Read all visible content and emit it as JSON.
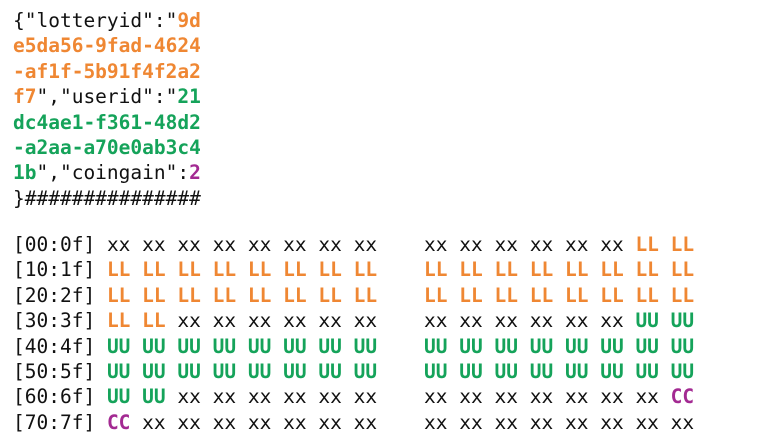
{
  "json_lines": [
    [
      {
        "t": "{\"lotteryid\":\"",
        "c": "plain"
      },
      {
        "t": "9d",
        "c": "L"
      }
    ],
    [
      {
        "t": "e5da56-9fad-4624",
        "c": "L"
      }
    ],
    [
      {
        "t": "-af1f-5b91f4f2a2",
        "c": "L"
      }
    ],
    [
      {
        "t": "f7",
        "c": "L"
      },
      {
        "t": "\",\"userid\":\"",
        "c": "plain"
      },
      {
        "t": "21",
        "c": "U"
      }
    ],
    [
      {
        "t": "dc4ae1-f361-48d2",
        "c": "U"
      }
    ],
    [
      {
        "t": "-a2aa-a70e0ab3c4",
        "c": "U"
      }
    ],
    [
      {
        "t": "1b",
        "c": "U"
      },
      {
        "t": "\",\"coingain\":",
        "c": "plain"
      },
      {
        "t": "2",
        "c": "C"
      }
    ],
    [
      {
        "t": "}###############",
        "c": "plain"
      }
    ]
  ],
  "rows": [
    {
      "label": "[00:0f]",
      "cells": [
        "xx",
        "xx",
        "xx",
        "xx",
        "xx",
        "xx",
        "xx",
        "xx",
        "xx",
        "xx",
        "xx",
        "xx",
        "xx",
        "xx",
        "LL",
        "LL"
      ]
    },
    {
      "label": "[10:1f]",
      "cells": [
        "LL",
        "LL",
        "LL",
        "LL",
        "LL",
        "LL",
        "LL",
        "LL",
        "LL",
        "LL",
        "LL",
        "LL",
        "LL",
        "LL",
        "LL",
        "LL"
      ]
    },
    {
      "label": "[20:2f]",
      "cells": [
        "LL",
        "LL",
        "LL",
        "LL",
        "LL",
        "LL",
        "LL",
        "LL",
        "LL",
        "LL",
        "LL",
        "LL",
        "LL",
        "LL",
        "LL",
        "LL"
      ]
    },
    {
      "label": "[30:3f]",
      "cells": [
        "LL",
        "LL",
        "xx",
        "xx",
        "xx",
        "xx",
        "xx",
        "xx",
        "xx",
        "xx",
        "xx",
        "xx",
        "xx",
        "xx",
        "UU",
        "UU"
      ]
    },
    {
      "label": "[40:4f]",
      "cells": [
        "UU",
        "UU",
        "UU",
        "UU",
        "UU",
        "UU",
        "UU",
        "UU",
        "UU",
        "UU",
        "UU",
        "UU",
        "UU",
        "UU",
        "UU",
        "UU"
      ]
    },
    {
      "label": "[50:5f]",
      "cells": [
        "UU",
        "UU",
        "UU",
        "UU",
        "UU",
        "UU",
        "UU",
        "UU",
        "UU",
        "UU",
        "UU",
        "UU",
        "UU",
        "UU",
        "UU",
        "UU"
      ]
    },
    {
      "label": "[60:6f]",
      "cells": [
        "UU",
        "UU",
        "xx",
        "xx",
        "xx",
        "xx",
        "xx",
        "xx",
        "xx",
        "xx",
        "xx",
        "xx",
        "xx",
        "xx",
        "xx",
        "CC"
      ]
    },
    {
      "label": "[70:7f]",
      "cells": [
        "CC",
        "xx",
        "xx",
        "xx",
        "xx",
        "xx",
        "xx",
        "xx",
        "xx",
        "xx",
        "xx",
        "xx",
        "xx",
        "xx",
        "xx",
        "xx"
      ]
    }
  ],
  "colors": {
    "text": "#111111",
    "lotteryid": "#ef8733",
    "userid": "#15a35a",
    "coingain": "#a32a92",
    "background": "#ffffff"
  }
}
